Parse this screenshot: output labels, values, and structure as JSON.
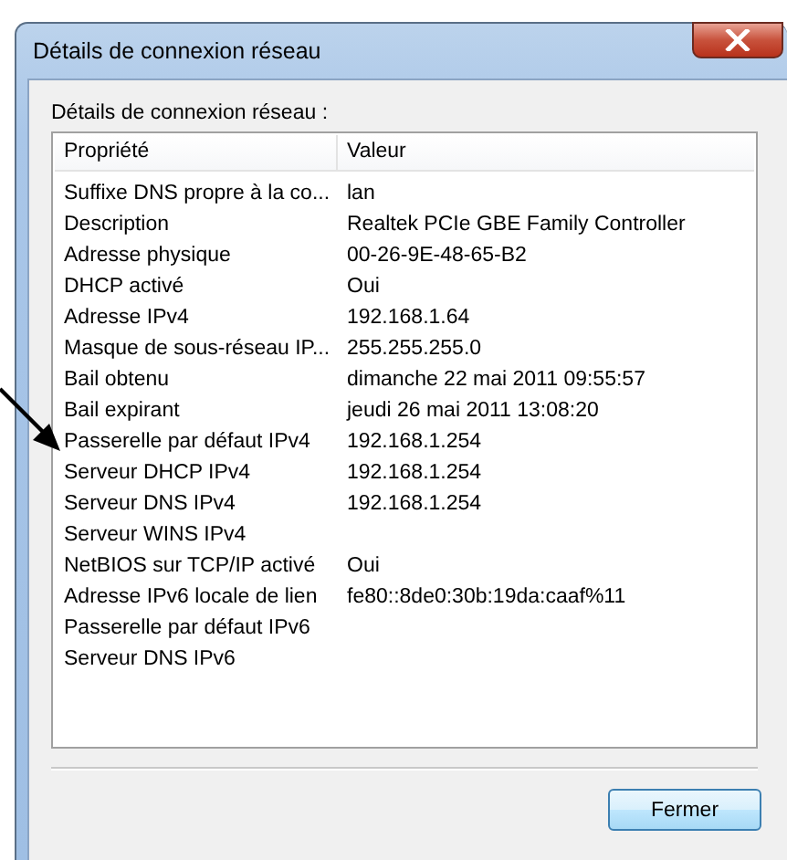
{
  "window": {
    "title": "Détails de connexion réseau"
  },
  "list_label": "Détails de connexion réseau :",
  "table": {
    "columns": [
      "Propriété",
      "Valeur"
    ],
    "rows": [
      {
        "property": "Suffixe DNS propre à la co...",
        "value": "lan"
      },
      {
        "property": "Description",
        "value": "Realtek PCIe GBE Family Controller"
      },
      {
        "property": "Adresse physique",
        "value": "00-26-9E-48-65-B2"
      },
      {
        "property": "DHCP activé",
        "value": "Oui"
      },
      {
        "property": "Adresse IPv4",
        "value": "192.168.1.64"
      },
      {
        "property": "Masque de sous-réseau IP...",
        "value": "255.255.255.0"
      },
      {
        "property": "Bail obtenu",
        "value": "dimanche 22 mai 2011 09:55:57"
      },
      {
        "property": "Bail expirant",
        "value": "jeudi 26 mai 2011 13:08:20"
      },
      {
        "property": "Passerelle par défaut IPv4",
        "value": "192.168.1.254"
      },
      {
        "property": "Serveur DHCP IPv4",
        "value": "192.168.1.254"
      },
      {
        "property": "Serveur DNS IPv4",
        "value": "192.168.1.254"
      },
      {
        "property": "Serveur WINS IPv4"
      },
      {
        "property": "NetBIOS sur TCP/IP activé",
        "value": "Oui"
      },
      {
        "property": "Adresse IPv6 locale de lien",
        "value": "fe80::8de0:30b:19da:caaf%11"
      },
      {
        "property": "Passerelle par défaut IPv6"
      },
      {
        "property": "Serveur DNS IPv6"
      }
    ]
  },
  "buttons": [
    "Fermer"
  ]
}
